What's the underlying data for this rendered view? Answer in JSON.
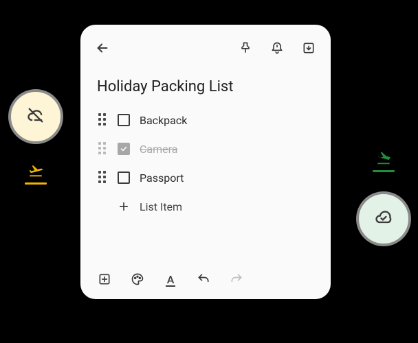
{
  "note": {
    "title": "Holiday Packing List",
    "items": [
      {
        "label": "Backpack",
        "checked": false
      },
      {
        "label": "Camera",
        "checked": true
      },
      {
        "label": "Passport",
        "checked": false
      }
    ],
    "add_item_label": "List Item"
  },
  "icons": {
    "back": "back-arrow",
    "pin": "pin",
    "reminder": "bell-alert",
    "archive": "archive",
    "cloud_off": "cloud-off",
    "cloud_done": "cloud-done",
    "flight_takeoff": "flight-takeoff",
    "flight_land": "flight-land",
    "add_box": "add-box",
    "palette": "palette",
    "text_format": "A",
    "undo": "undo",
    "redo": "redo",
    "plus": "+"
  }
}
